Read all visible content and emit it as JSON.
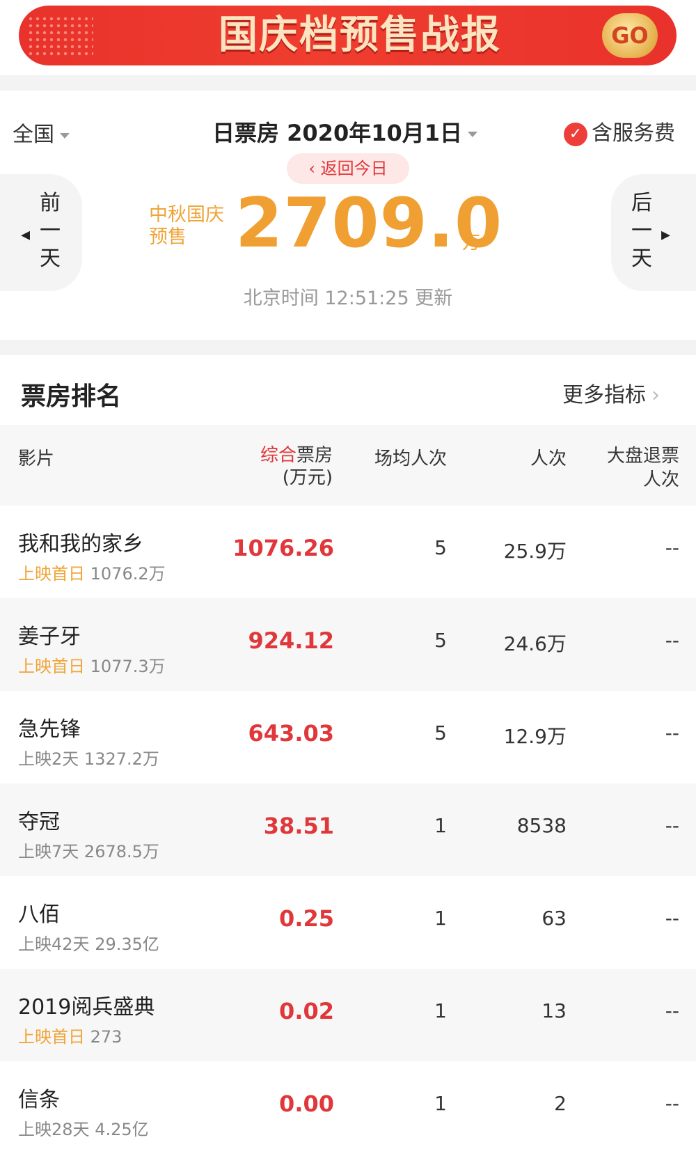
{
  "banner": {
    "title": "国庆档预售战报",
    "go_label": "GO"
  },
  "header": {
    "region": "全国",
    "date_title": "日票房 2020年10月1日",
    "service_fee": "含服务费",
    "back_today": "‹ 返回今日",
    "prev_day": [
      "前",
      "一",
      "天"
    ],
    "next_day": [
      "后",
      "一",
      "天"
    ],
    "presale_label": "中秋国庆预售",
    "total_value": "2709.0",
    "total_unit": "万",
    "update_time": "北京时间 12:51:25 更新"
  },
  "ranking": {
    "title": "票房排名",
    "more_metrics": "更多指标",
    "columns": {
      "film": "影片",
      "box_red": "综合",
      "box_rest": "票房",
      "box_unit": "(万元)",
      "avg": "场均人次",
      "views": "人次",
      "refund_1": "大盘退票",
      "refund_2": "人次"
    },
    "rows": [
      {
        "name": "我和我的家乡",
        "tag": "上映首日",
        "info": "1076.2万",
        "box": "1076.26",
        "avg": "5",
        "views": "25.9万",
        "refund": "--"
      },
      {
        "name": "姜子牙",
        "tag": "上映首日",
        "info": "1077.3万",
        "box": "924.12",
        "avg": "5",
        "views": "24.6万",
        "refund": "--"
      },
      {
        "name": "急先锋",
        "tag": "上映2天",
        "info": "1327.2万",
        "box": "643.03",
        "avg": "5",
        "views": "12.9万",
        "refund": "--"
      },
      {
        "name": "夺冠",
        "tag": "上映7天",
        "info": "2678.5万",
        "box": "38.51",
        "avg": "1",
        "views": "8538",
        "refund": "--"
      },
      {
        "name": "八佰",
        "tag": "上映42天",
        "info": "29.35亿",
        "box": "0.25",
        "avg": "1",
        "views": "63",
        "refund": "--"
      },
      {
        "name": "2019阅兵盛典",
        "tag": "上映首日",
        "info": "273",
        "box": "0.02",
        "avg": "1",
        "views": "13",
        "refund": "--"
      },
      {
        "name": "信条",
        "tag": "上映28天",
        "info": "4.25亿",
        "box": "0.00",
        "avg": "1",
        "views": "2",
        "refund": "--"
      }
    ]
  },
  "colors": {
    "accent_red": "#e0373a",
    "accent_orange": "#f0a032",
    "banner_red": "#e8322b"
  }
}
